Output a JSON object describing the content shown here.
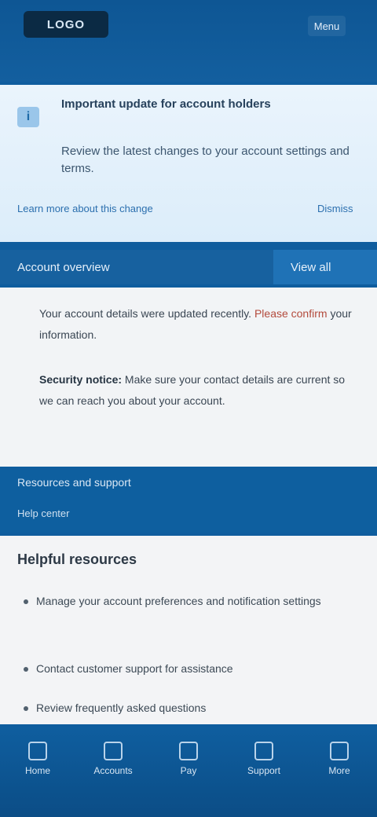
{
  "header": {
    "logo": "LOGO",
    "menu_label": "Menu"
  },
  "notice": {
    "title": "Important update for account holders",
    "body": "Review the latest changes to your account settings and terms.",
    "link_label": "Learn more about this change",
    "close_label": "Dismiss"
  },
  "section1": {
    "title": "Account overview",
    "aside": "View all"
  },
  "card1": {
    "p1_a": "Your account details were updated recently.",
    "p1_hl": "Please confirm",
    "p1_b": "your information.",
    "p2_strong": "Security notice:",
    "p2_b": "Make sure your contact details are current so we can reach you about your account."
  },
  "band2": {
    "title": "Resources and support",
    "sub": "Help center"
  },
  "card2": {
    "title": "Helpful resources",
    "items": [
      "Manage your account preferences and notification settings",
      "Contact customer support for assistance",
      "Review frequently asked questions"
    ]
  },
  "footer": {
    "items": [
      "Home",
      "Accounts",
      "Pay",
      "Support",
      "More"
    ]
  },
  "colors": {
    "brand": "#0f5d9e",
    "accent": "#2b6fae",
    "highlight": "#b34a3c"
  }
}
